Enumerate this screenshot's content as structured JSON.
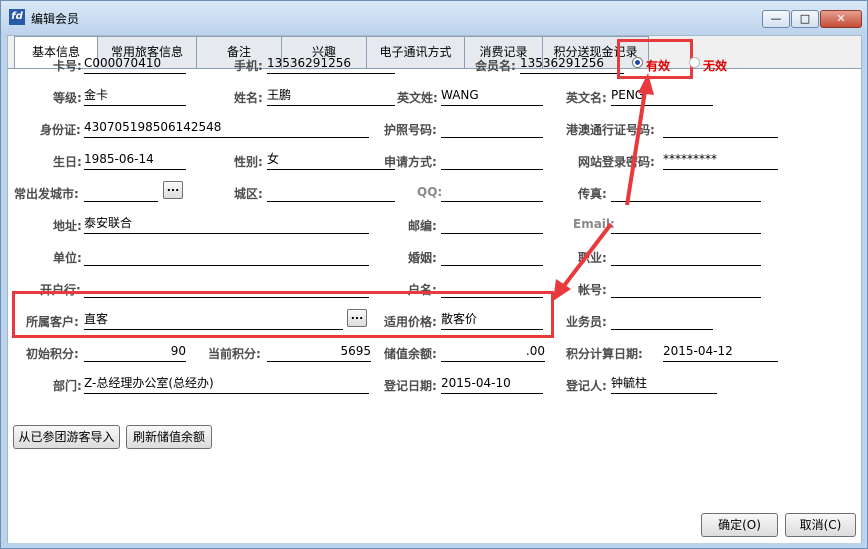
{
  "window": {
    "title": "编辑会员",
    "title_icon": "fd"
  },
  "tabs": [
    "基本信息",
    "常用旅客信息",
    "备注",
    "兴趣",
    "电子通讯方式",
    "消费记录",
    "积分送现金记录"
  ],
  "labels": {
    "card_no": "卡号:",
    "mobile": "手机:",
    "member_name": "会员名:",
    "level": "等级:",
    "name": "姓名:",
    "en_surname": "英文姓:",
    "en_name": "英文名:",
    "id_card": "身份证:",
    "passport": "护照号码:",
    "hk_permit": "港澳通行证号码:",
    "birthday": "生日:",
    "gender": "性别:",
    "apply_method": "申请方式:",
    "web_pwd": "网站登录密码:",
    "depart_city": "常出发城市:",
    "district": "城区:",
    "qq": "QQ:",
    "fax": "传真:",
    "address": "地址:",
    "postcode": "邮编:",
    "email": "Email:",
    "unit": "单位:",
    "marriage": "婚姻:",
    "occupation": "职业:",
    "bank": "开户行:",
    "account_name": "户名:",
    "account_no": "帐号:",
    "customer": "所属客户:",
    "price": "适用价格:",
    "salesman": "业务员:",
    "init_points": "初始积分:",
    "cur_points": "当前积分:",
    "balance": "储值余额:",
    "points_date": "积分计算日期:",
    "dept": "部门:",
    "reg_date": "登记日期:",
    "registrar": "登记人:"
  },
  "values": {
    "card_no": "C000070410",
    "mobile": "13536291256",
    "member_name": "13536291256",
    "level": "金卡",
    "name": "王鹏",
    "en_surname": "WANG",
    "en_name": "PENG",
    "id_card": "430705198506142548",
    "passport": "",
    "hk_permit": "",
    "birthday": "1985-06-14",
    "gender": "女",
    "apply_method": "",
    "web_pwd": "*********",
    "depart_city": "",
    "district": "",
    "qq": "",
    "fax": "",
    "address": "泰安联合",
    "postcode": "",
    "email": "",
    "unit": "",
    "marriage": "",
    "occupation": "",
    "bank": "",
    "account_name": "",
    "account_no": "",
    "customer": "直客",
    "price": "散客价",
    "salesman": "",
    "init_points": "90",
    "cur_points": "5695",
    "balance": ".00",
    "points_date": "2015-04-12",
    "dept": "Z-总经理办公室(总经办)",
    "reg_date": "2015-04-10",
    "registrar": "钟毓柱"
  },
  "status": {
    "valid": "有效",
    "invalid": "无效",
    "selected": "valid"
  },
  "buttons": {
    "ellipsis": "...",
    "import": "从已参团游客导入",
    "refresh": "刷新储值余额",
    "ok": "确定(O)",
    "cancel": "取消(C)"
  },
  "colors": {
    "highlight": "#e8393c",
    "status_text": "#e00000",
    "radio_dot": "#1a4aa8"
  }
}
